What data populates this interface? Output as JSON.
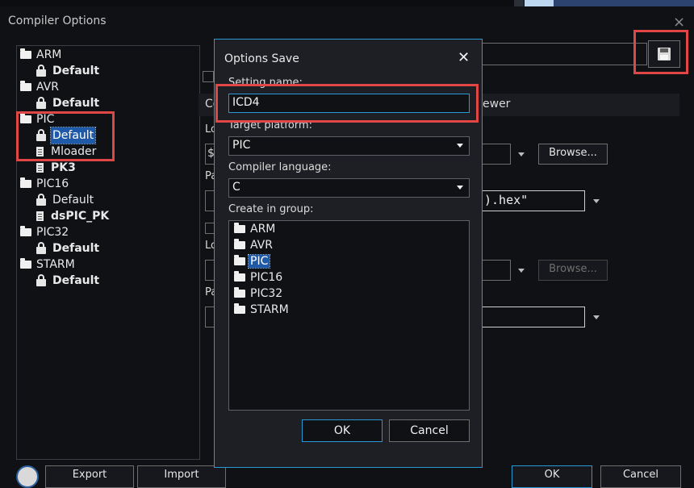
{
  "window": {
    "title": "Compiler Options",
    "close_glyph": "×"
  },
  "tree": {
    "groups": [
      {
        "label": "ARM",
        "children": [
          {
            "label": "Default",
            "icon": "lock-icon",
            "bold": true
          }
        ]
      },
      {
        "label": "AVR",
        "children": [
          {
            "label": "Default",
            "icon": "lock-icon",
            "bold": true
          }
        ]
      },
      {
        "label": "PIC",
        "children": [
          {
            "label": "Default",
            "icon": "lock-icon",
            "bold": false,
            "selected": true
          },
          {
            "label": "Mloader",
            "icon": "doc-icon",
            "bold": false
          },
          {
            "label": "PK3",
            "icon": "doc-icon",
            "bold": true
          }
        ]
      },
      {
        "label": "PIC16",
        "children": [
          {
            "label": "Default",
            "icon": "lock-icon",
            "bold": false
          },
          {
            "label": "dsPIC_PK",
            "icon": "doc-icon",
            "bold": true
          }
        ]
      },
      {
        "label": "PIC32",
        "children": [
          {
            "label": "Default",
            "icon": "lock-icon",
            "bold": true
          }
        ]
      },
      {
        "label": "STARM",
        "children": [
          {
            "label": "Default",
            "icon": "lock-icon",
            "bold": true
          }
        ]
      }
    ]
  },
  "background": {
    "tab_fragment": "Co",
    "tab_fragment_right": "ewer",
    "label_lo1": "Lo",
    "label_pa1": "Pa",
    "label_lo2": "Lo",
    "label_pa2": "Pa",
    "path1_fragment": "$",
    "hex_fragment": ").hex\"",
    "browse_label": "Browse...",
    "browse2_label": "Browse..."
  },
  "dialog": {
    "title": "Options Save",
    "close_glyph": "✕",
    "setting_name_label": "Setting name:",
    "setting_name_value": "ICD4",
    "target_platform_label": "Target platform:",
    "target_platform_value": "PIC",
    "compiler_language_label": "Compiler language:",
    "compiler_language_value": "C",
    "create_in_group_label": "Create in group:",
    "groups": [
      "ARM",
      "AVR",
      "PIC",
      "PIC16",
      "PIC32",
      "STARM"
    ],
    "selected_group": "PIC",
    "ok_label": "OK",
    "cancel_label": "Cancel"
  },
  "footer": {
    "btn1": "Export",
    "btn2": "Import",
    "ok": "OK",
    "cancel": "Cancel"
  },
  "colors": {
    "accent": "#2b98d6",
    "highlight": "#e14646",
    "selection": "#1f5aa8"
  }
}
